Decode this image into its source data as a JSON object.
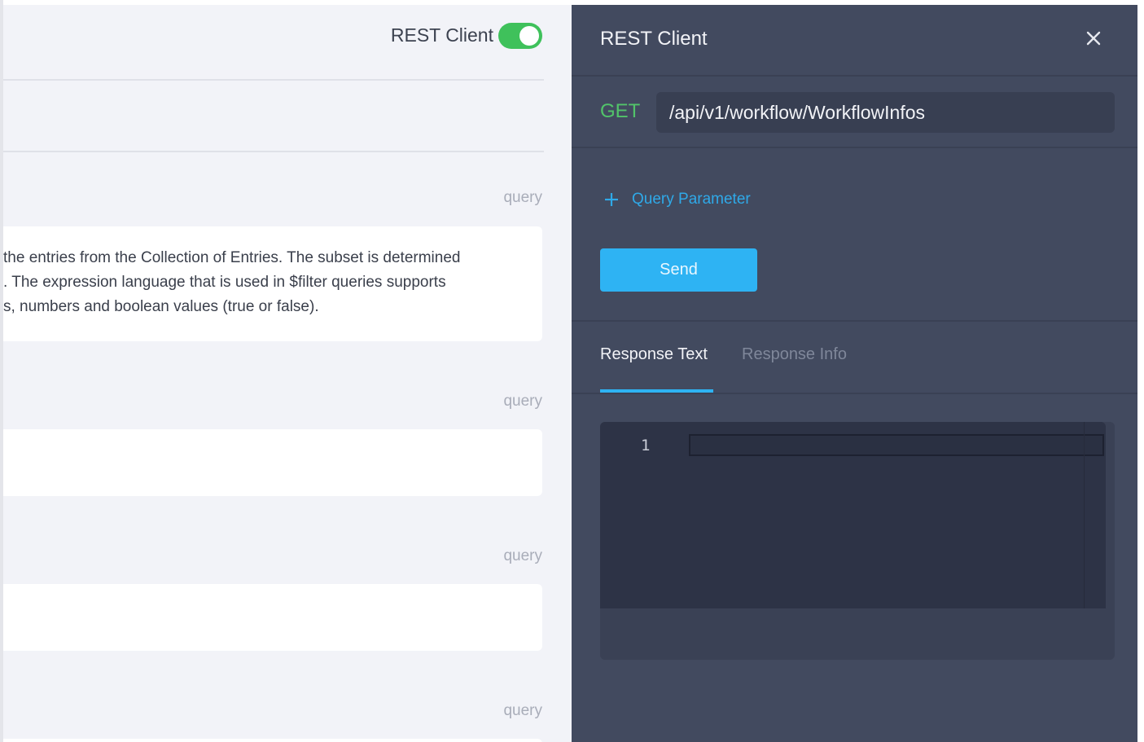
{
  "left": {
    "toggle_label": "REST Client",
    "toggle_on": true,
    "params": [
      {
        "type": "query",
        "description": [
          "the entries from the Collection of Entries. The subset is determined",
          ". The expression language that is used in $filter queries supports",
          "s, numbers and boolean values (true or false)."
        ]
      },
      {
        "type": "query",
        "description": []
      },
      {
        "type": "query",
        "description": []
      },
      {
        "type": "query",
        "description": []
      }
    ]
  },
  "rest": {
    "title": "REST Client",
    "close_icon": "close-icon",
    "method": "GET",
    "url": "/api/v1/workflow/WorkflowInfos",
    "add_param_label": "Query Parameter",
    "send_label": "Send",
    "tabs": [
      {
        "label": "Response Text",
        "active": true
      },
      {
        "label": "Response Info",
        "active": false
      }
    ],
    "editor_line": "1"
  },
  "colors": {
    "accent_blue": "#2eb3f3",
    "method_green": "#52c46a",
    "toggle_green": "#3fc15b",
    "panel_dark": "#424a5f"
  }
}
